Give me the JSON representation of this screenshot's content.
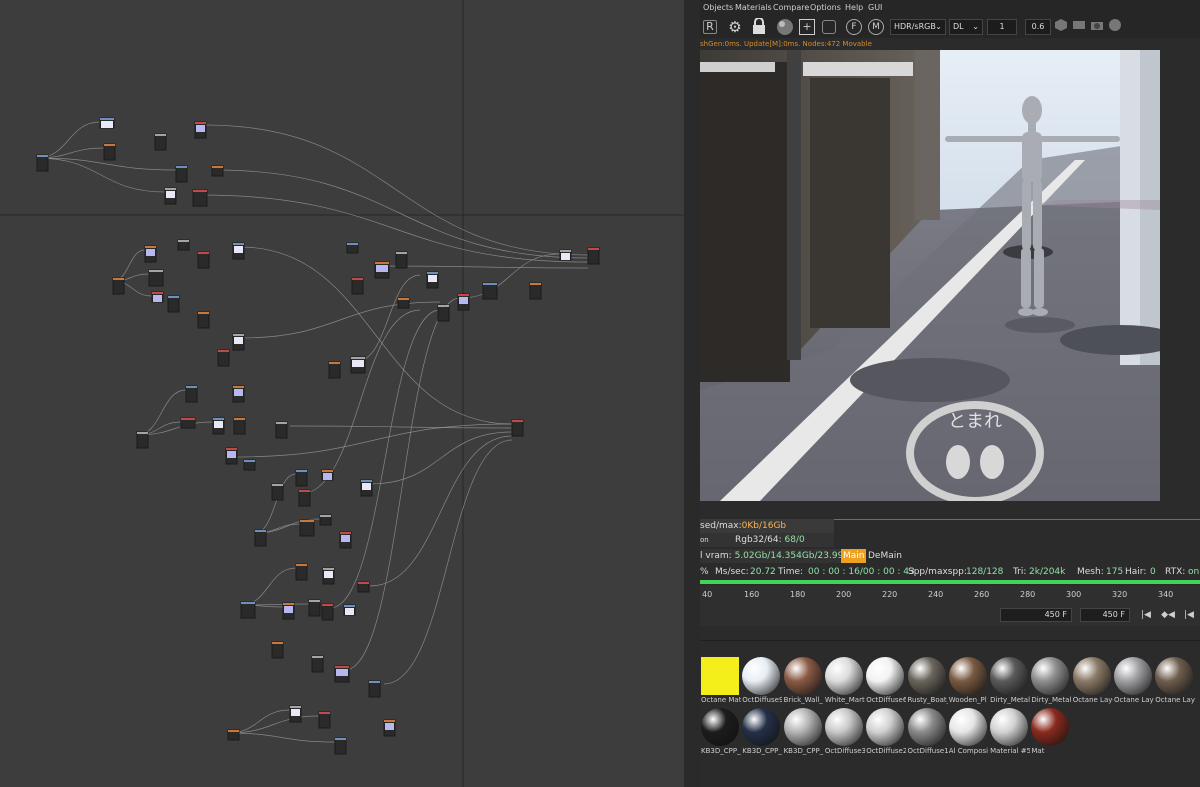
{
  "menu": [
    "Objects",
    "Materials",
    "Compare",
    "Options",
    "Help",
    "GUI"
  ],
  "toolbar": {
    "icons": [
      "R",
      "⚙",
      "🔒",
      "●",
      "+",
      "□",
      "F",
      "M"
    ],
    "color_mode": "HDR/sRGB",
    "kernel": "DL",
    "value1": "1",
    "value2": "0.6"
  },
  "status_line": "shGen:0ms. Update[M]:0ms. Nodes:472 Movable",
  "stats": {
    "used_label": "sed/max:",
    "used_value": "0Kb/16Gb",
    "on_label": "on",
    "rgb_label": "Rgb32/64:",
    "rgb_value": "68/0",
    "vram_label": "l vram:",
    "vram_value": "5.02Gb/14.354Gb/23.99",
    "main_tab": "Main",
    "demain_tab": "DeMain"
  },
  "info": {
    "pct": "%",
    "ms_label": "Ms/sec:",
    "ms_value": "20.72",
    "time_label": "Time:",
    "time_value": "00 : 00 : 16/00 : 00 : 43",
    "spp_label": "Spp/maxspp:",
    "spp_value": "128/128",
    "tri_label": "Tri:",
    "tri_value": "2k/204k",
    "mesh_label": "Mesh:",
    "mesh_value": "175",
    "hair_label": "Hair:",
    "hair_value": "0",
    "rtx_label": "RTX:",
    "rtx_value": "on"
  },
  "progress": 1.0,
  "timeline": {
    "ticks": [
      "40",
      "160",
      "180",
      "200",
      "220",
      "240",
      "260",
      "280",
      "300",
      "320",
      "340"
    ],
    "frame_current": "450 F",
    "frame_end": "450 F"
  },
  "materials": [
    {
      "label": "Octane Mat",
      "color": "#f4ef1a"
    },
    {
      "label": "OctDiffuse9",
      "color": "#e8eef4"
    },
    {
      "label": "Brick_Wall_",
      "color": "#8a5a44"
    },
    {
      "label": "White_Mart",
      "color": "#dcdcdc"
    },
    {
      "label": "OctDiffuse6",
      "color": "#f2f2f2"
    },
    {
      "label": "Rusty_Boat_",
      "color": "#6a655c"
    },
    {
      "label": "Wooden_Pl",
      "color": "#7a5a42"
    },
    {
      "label": "Dirty_Metal",
      "color": "#5a5a5a"
    },
    {
      "label": "Dirty_Metal",
      "color": "#8e8e8e"
    },
    {
      "label": "Octane Laye",
      "color": "#8a7a66"
    },
    {
      "label": "Octane Laye",
      "color": "#a0a0a4"
    },
    {
      "label": "Octane Laye",
      "color": "#6e5e4e"
    },
    {
      "label": "KB3D_CPP_",
      "color": "#1c1c1c"
    },
    {
      "label": "KB3D_CPP_",
      "color": "#243048"
    },
    {
      "label": "KB3D_CPP_",
      "color": "#b4b4b4"
    },
    {
      "label": "OctDiffuse3",
      "color": "#c8c8c8"
    },
    {
      "label": "OctDiffuse2",
      "color": "#d0d0d0"
    },
    {
      "label": "OctDiffuse1",
      "color": "#8a8a8a"
    },
    {
      "label": "Al Composi",
      "color": "#e6e6e6"
    },
    {
      "label": "Material #5",
      "color": "#d2d2d2"
    },
    {
      "label": "Mat",
      "color": "#8a2a1e"
    }
  ],
  "render": {
    "road_sign": "とまれ"
  }
}
